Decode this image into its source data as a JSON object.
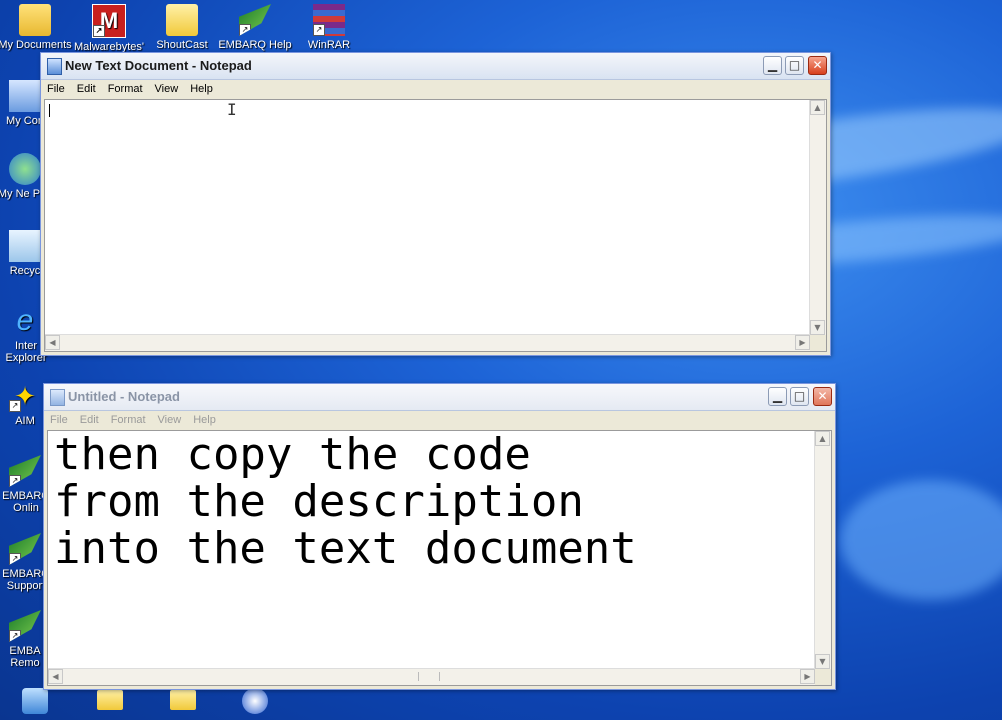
{
  "desktop": {
    "icons_top": [
      {
        "label": "My Documents",
        "name": "my-documents-icon"
      },
      {
        "label": "Malwarebytes'",
        "name": "malwarebytes-icon"
      },
      {
        "label": "ShoutCast",
        "name": "shoutcast-folder-icon"
      },
      {
        "label": "EMBARQ Help",
        "name": "embarq-help-icon"
      },
      {
        "label": "WinRAR",
        "name": "winrar-icon"
      }
    ],
    "icons_left": [
      {
        "label": "My Con",
        "name": "my-computer-icon"
      },
      {
        "label": "My Ne Plac",
        "name": "my-network-places-icon"
      },
      {
        "label": "Recyc",
        "name": "recycle-bin-icon"
      },
      {
        "label": "Inter Explorer",
        "name": "internet-explorer-icon"
      },
      {
        "label": "AIM",
        "name": "aim-icon"
      },
      {
        "label": "EMBARQ Onlin",
        "name": "embarq-online-icon"
      },
      {
        "label": "EMBARQ Support",
        "name": "embarq-support-icon"
      },
      {
        "label": "EMBA Remo",
        "name": "embarq-remote-icon"
      }
    ]
  },
  "window1": {
    "title": "New Text Document - Notepad",
    "menu": [
      "File",
      "Edit",
      "Format",
      "View",
      "Help"
    ],
    "content": ""
  },
  "window2": {
    "title": "Untitled - Notepad",
    "menu": [
      "File",
      "Edit",
      "Format",
      "View",
      "Help"
    ],
    "lines": [
      "then copy the code",
      "from the description",
      "into the text document"
    ]
  },
  "colors": {
    "desktop": "#1d63d6",
    "close_button": "#d8401c"
  }
}
